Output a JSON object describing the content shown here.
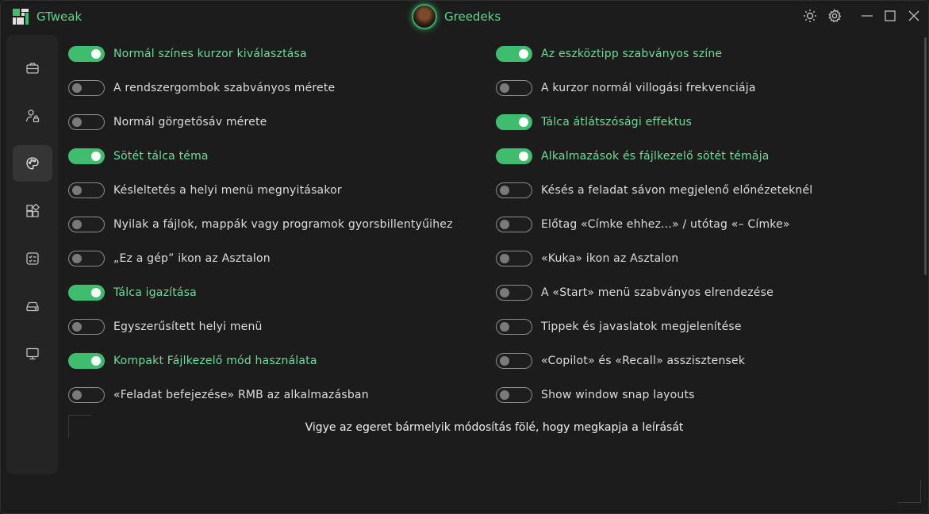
{
  "app": {
    "title": "GTweak"
  },
  "user": {
    "name": "Greedeks"
  },
  "hint": "Vigye az egeret bármelyik módosítás fölé, hogy megkapja a leírását",
  "colors": {
    "accent": "#3fbd6f",
    "accent_text": "#6fdc9a",
    "background": "#1c1c1c"
  },
  "sidebar": {
    "items": [
      {
        "icon": "briefcase-icon",
        "active": false
      },
      {
        "icon": "user-lock-icon",
        "active": false
      },
      {
        "icon": "palette-icon",
        "active": true
      },
      {
        "icon": "apps-icon",
        "active": false
      },
      {
        "icon": "checklist-icon",
        "active": false
      },
      {
        "icon": "drive-icon",
        "active": false
      },
      {
        "icon": "monitor-icon",
        "active": false
      }
    ]
  },
  "options": {
    "left": [
      {
        "label": "Normál színes kurzor kiválasztása",
        "on": true
      },
      {
        "label": "A rendszergombok szabványos mérete",
        "on": false
      },
      {
        "label": "Normál görgetősáv mérete",
        "on": false
      },
      {
        "label": "Sötét tálca téma",
        "on": true
      },
      {
        "label": "Késleltetés a helyi menü megnyitásakor",
        "on": false
      },
      {
        "label": "Nyilak a fájlok, mappák vagy programok gyorsbillentyűihez",
        "on": false
      },
      {
        "label": "„Ez a gép” ikon az Asztalon",
        "on": false
      },
      {
        "label": "Tálca igazítása",
        "on": true
      },
      {
        "label": "Egyszerűsített helyi menü",
        "on": false
      },
      {
        "label": "Kompakt Fájlkezelő mód használata",
        "on": true
      },
      {
        "label": "«Feladat befejezése» RMB az alkalmazásban",
        "on": false
      }
    ],
    "right": [
      {
        "label": "Az eszköztipp szabványos színe",
        "on": true
      },
      {
        "label": "A kurzor normál villogási frekvenciája",
        "on": false
      },
      {
        "label": "Tálca átlátszósági effektus",
        "on": true
      },
      {
        "label": "Alkalmazások és fájlkezelő sötét témája",
        "on": true
      },
      {
        "label": "Késés a feladat sávon megjelenő előnézeteknél",
        "on": false
      },
      {
        "label": "Előtag «Címke ehhez...» / utótag «– Címke»",
        "on": false
      },
      {
        "label": "«Kuka» ikon az Asztalon",
        "on": false
      },
      {
        "label": "A «Start» menü szabványos elrendezése",
        "on": false
      },
      {
        "label": "Tippek és javaslatok megjelenítése",
        "on": false
      },
      {
        "label": "«Copilot» és «Recall» asszisztensek",
        "on": false
      },
      {
        "label": "Show window snap layouts",
        "on": false
      }
    ]
  }
}
